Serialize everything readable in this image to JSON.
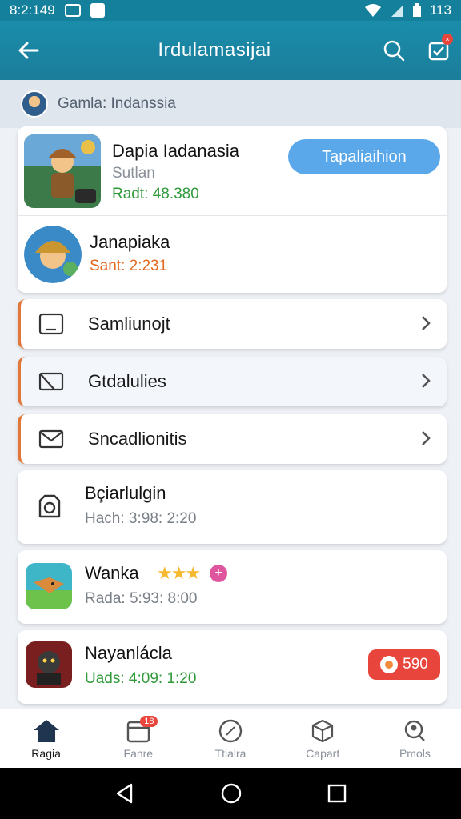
{
  "status_bar": {
    "time": "8:2:149",
    "battery": "113"
  },
  "app_bar": {
    "title": "Irdulamasijai"
  },
  "breadcrumb": {
    "text": "Gamla: Indanssia"
  },
  "featured": {
    "title": "Dapia Iadanasia",
    "subtitle": "Sutlan",
    "stat": "Radt: 48.380",
    "install_label": "Tapaliaihion"
  },
  "profile": {
    "name": "Janapiaka",
    "stat": "Sant: 2:231"
  },
  "menu": [
    {
      "label": "Samliunojt"
    },
    {
      "label": "Gtdalulies"
    },
    {
      "label": "Sncadlionitis"
    }
  ],
  "list": [
    {
      "title": "Bçiarlulgin",
      "sub": "Hach: 3:98: 2:20"
    },
    {
      "title": "Wanka",
      "sub": "Rada: 5:93: 8:00"
    },
    {
      "title": "Nayanlácla",
      "sub": "Uads: 4:09: 1:20",
      "price": "590"
    }
  ],
  "bottom_nav": [
    {
      "label": "Ragia",
      "icon": "home-icon",
      "active": true
    },
    {
      "label": "Fanre",
      "icon": "calendar-icon",
      "badge": "18"
    },
    {
      "label": "Ttialra",
      "icon": "compass-icon"
    },
    {
      "label": "Capart",
      "icon": "box-icon"
    },
    {
      "label": "Pmols",
      "icon": "search-user-icon"
    }
  ],
  "colors": {
    "primary": "#1a8dab",
    "accent": "#e2773a",
    "button": "#5aa8ea",
    "badge": "#e8453c",
    "green": "#2f9a3a"
  }
}
